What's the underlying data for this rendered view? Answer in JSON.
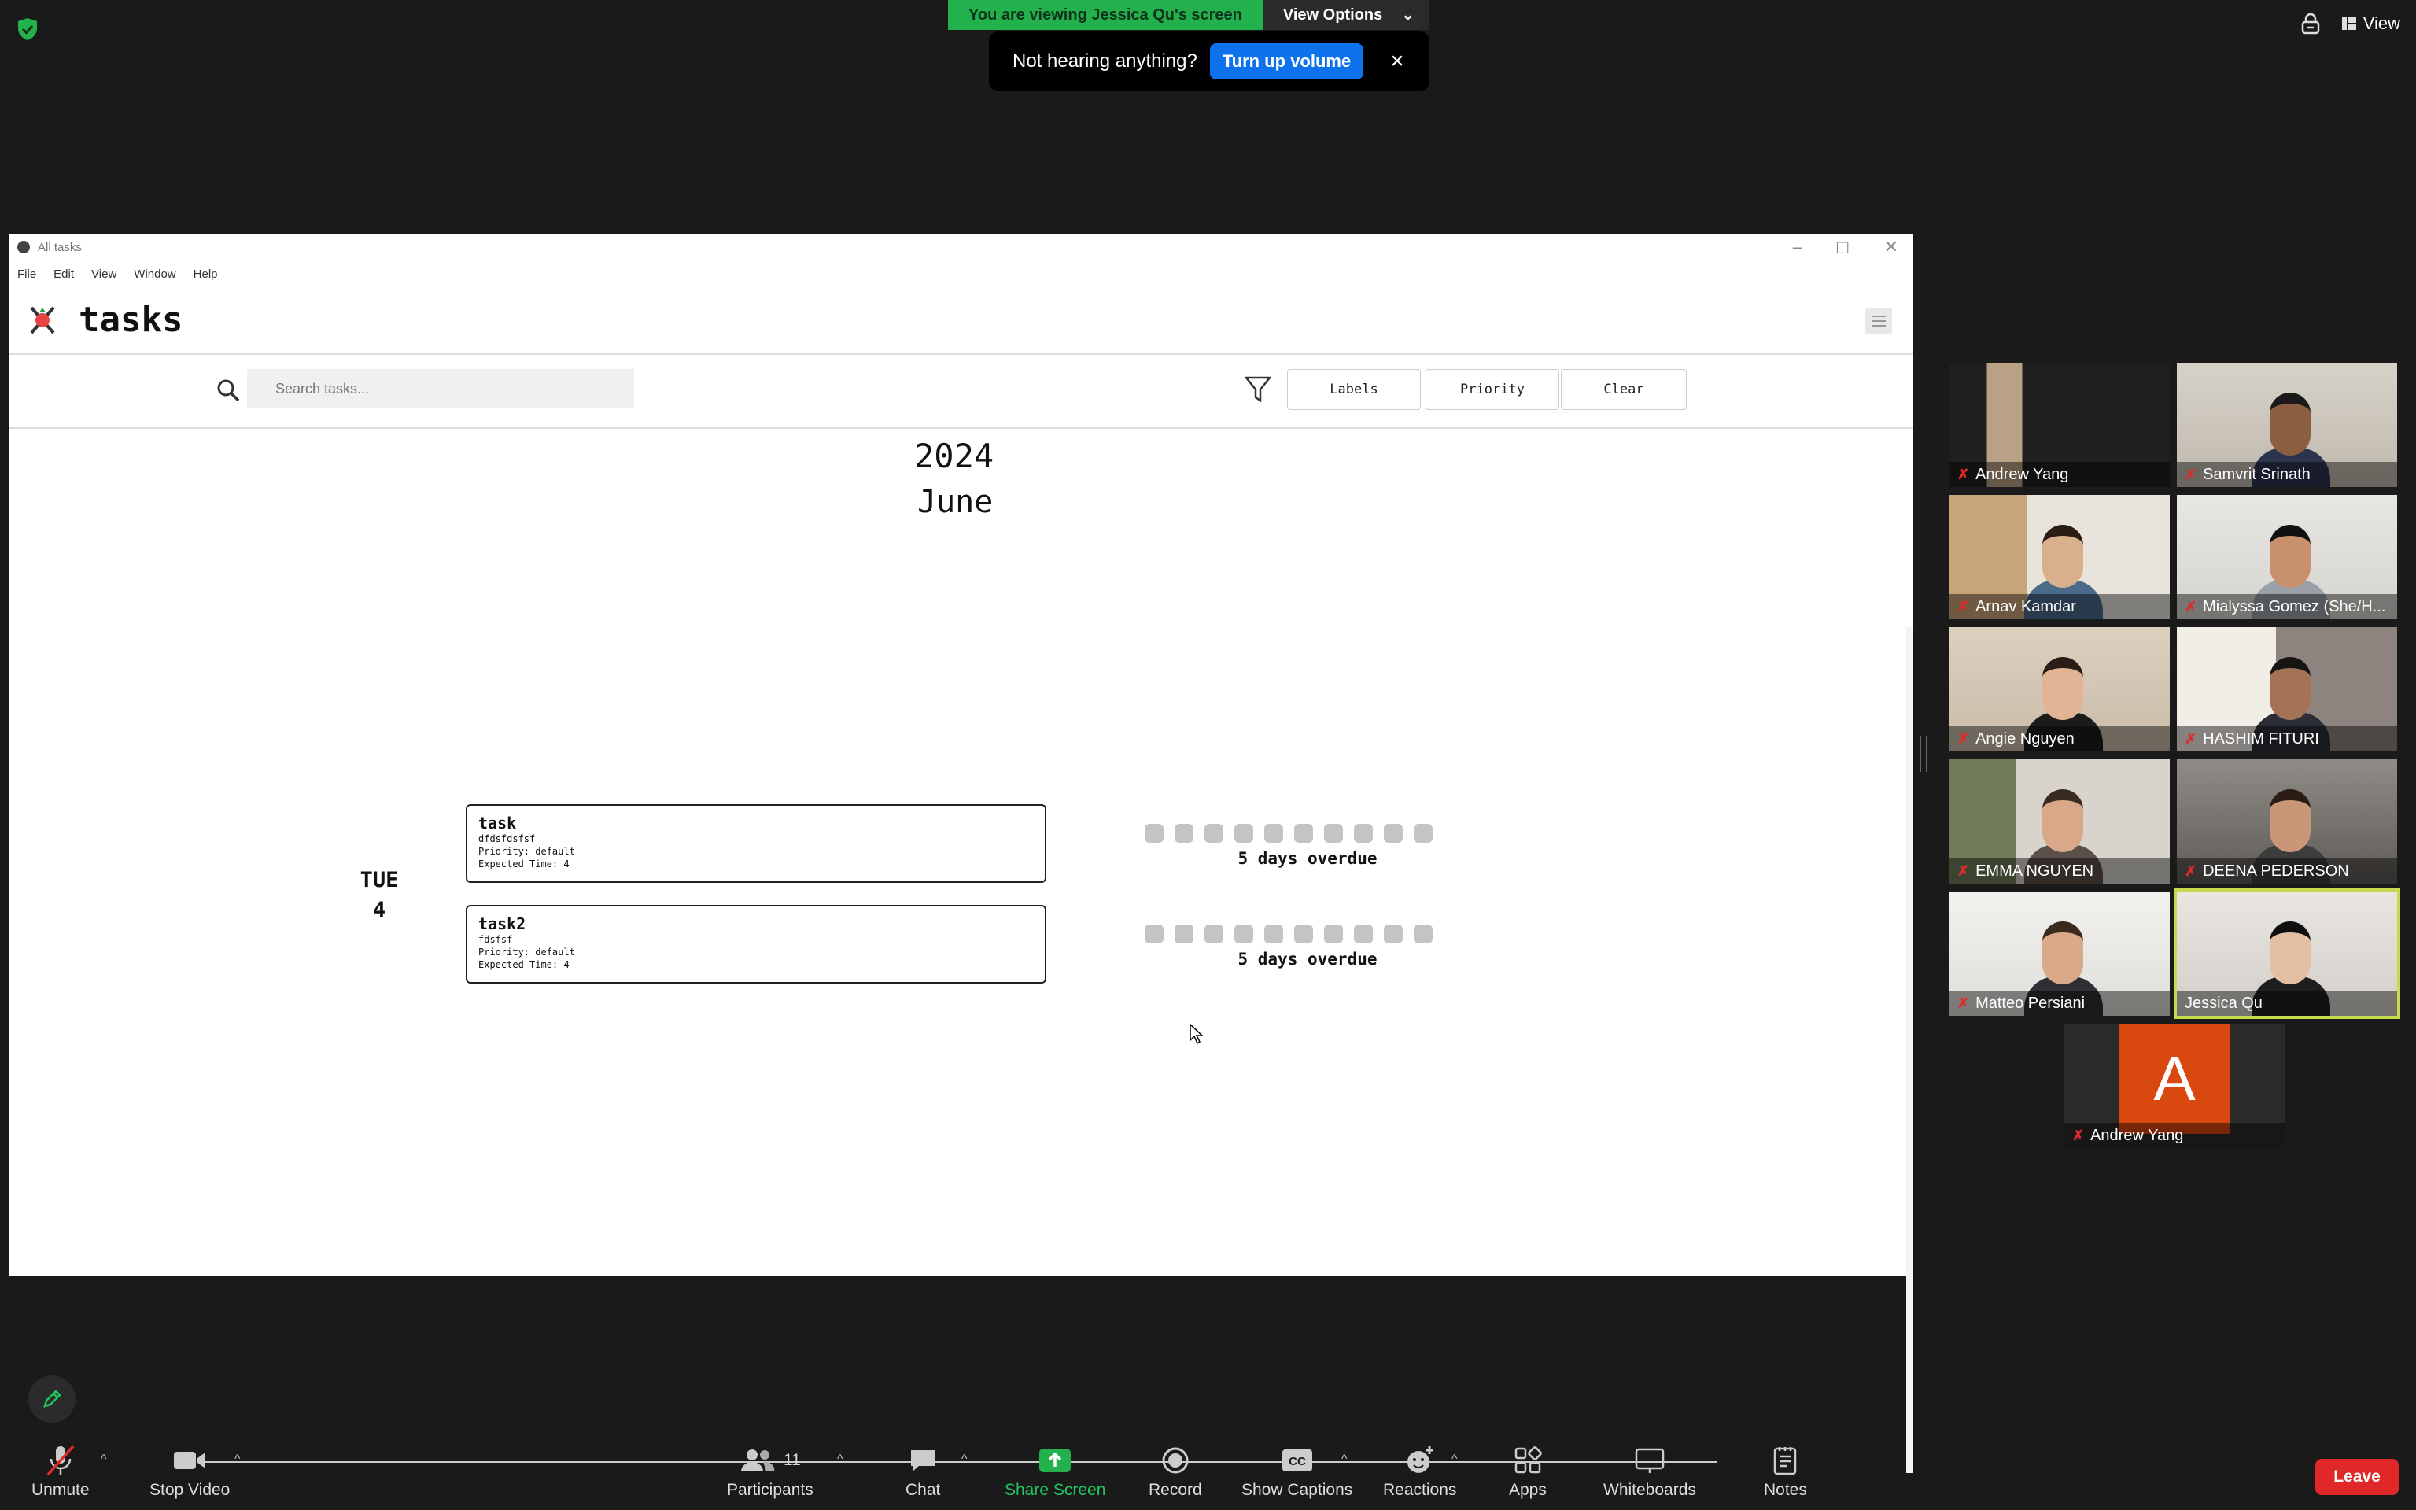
{
  "banner": {
    "viewing_text": "You are viewing Jessica Qu's screen",
    "view_options_label": "View Options"
  },
  "audio_toast": {
    "message": "Not hearing anything?",
    "button_label": "Turn up volume"
  },
  "top_right": {
    "view_label": "View"
  },
  "app": {
    "window_title": "All tasks",
    "menu": [
      "File",
      "Edit",
      "View",
      "Window",
      "Help"
    ],
    "name": "tasks",
    "search_placeholder": "Search tasks...",
    "filter_buttons": [
      "Labels",
      "Priority",
      "Clear"
    ],
    "year": "2024",
    "month": "June",
    "day": {
      "weekday": "TUE",
      "date": "4"
    },
    "tasks": [
      {
        "title": "task",
        "description": "dfdsfdsfsf",
        "priority": "Priority: default",
        "expected": "Expected Time: 4",
        "overdue": "5 days overdue",
        "progress_filled": 0,
        "progress_total": 10
      },
      {
        "title": "task2",
        "description": "fdsfsf",
        "priority": "Priority: default",
        "expected": "Expected Time: 4",
        "overdue": "5 days overdue",
        "progress_filled": 0,
        "progress_total": 10
      }
    ]
  },
  "participants": [
    {
      "name": "Andrew Yang",
      "muted": true
    },
    {
      "name": "Samvrit Srinath",
      "muted": true
    },
    {
      "name": "Arnav Kamdar",
      "muted": true
    },
    {
      "name": "Mialyssa Gomez (She/H...",
      "muted": true
    },
    {
      "name": "Angie Nguyen",
      "muted": true
    },
    {
      "name": "HASHIM FITURI",
      "muted": true
    },
    {
      "name": "EMMA NGUYEN",
      "muted": true
    },
    {
      "name": "DEENA PEDERSON",
      "muted": true
    },
    {
      "name": "Matteo Persiani",
      "muted": true
    },
    {
      "name": "Jessica Qu",
      "muted": false,
      "active_speaker": true
    },
    {
      "name": "Andrew Yang",
      "muted": true,
      "avatar_letter": "A",
      "avatar_color": "#d9480f"
    }
  ],
  "controls": {
    "unmute": "Unmute",
    "stop_video": "Stop Video",
    "participants": "Participants",
    "participants_count": "11",
    "chat": "Chat",
    "share_screen": "Share Screen",
    "record": "Record",
    "captions": "Show Captions",
    "reactions": "Reactions",
    "apps": "Apps",
    "whiteboards": "Whiteboards",
    "notes": "Notes",
    "leave": "Leave"
  },
  "colors": {
    "share_green": "#22b14c",
    "accent_blue": "#0e72ed",
    "leave_red": "#e02828",
    "active_border": "#c9d94f"
  }
}
